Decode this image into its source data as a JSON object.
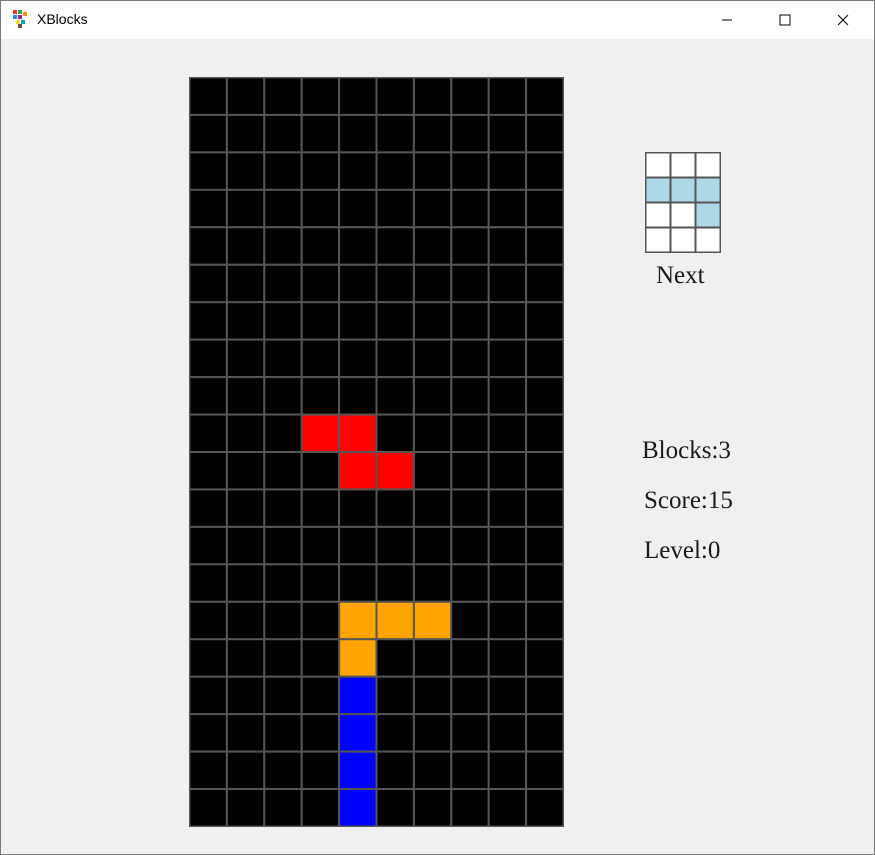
{
  "window": {
    "title": "XBlocks",
    "app_icon": "xblocks-app-icon",
    "controls": {
      "minimize_icon": "minimize-icon",
      "maximize_icon": "maximize-icon",
      "close_icon": "close-icon"
    }
  },
  "board": {
    "columns": 10,
    "rows": 20,
    "background_color": "#000000",
    "grid_line_color": "#555555",
    "filled_cells": [
      {
        "row": 9,
        "col": 3,
        "color": "#ff0000"
      },
      {
        "row": 9,
        "col": 4,
        "color": "#ff0000"
      },
      {
        "row": 10,
        "col": 4,
        "color": "#ff0000"
      },
      {
        "row": 10,
        "col": 5,
        "color": "#ff0000"
      },
      {
        "row": 14,
        "col": 4,
        "color": "#ffa500"
      },
      {
        "row": 14,
        "col": 5,
        "color": "#ffa500"
      },
      {
        "row": 14,
        "col": 6,
        "color": "#ffa500"
      },
      {
        "row": 15,
        "col": 4,
        "color": "#ffa500"
      },
      {
        "row": 16,
        "col": 4,
        "color": "#0000ff"
      },
      {
        "row": 17,
        "col": 4,
        "color": "#0000ff"
      },
      {
        "row": 18,
        "col": 4,
        "color": "#0000ff"
      },
      {
        "row": 19,
        "col": 4,
        "color": "#0000ff"
      }
    ]
  },
  "next_piece": {
    "label": "Next",
    "columns": 3,
    "rows": 4,
    "empty_color": "#ffffff",
    "grid_line_color": "#555555",
    "filled_cells": [
      {
        "row": 1,
        "col": 0,
        "color": "#add8e6"
      },
      {
        "row": 1,
        "col": 1,
        "color": "#add8e6"
      },
      {
        "row": 1,
        "col": 2,
        "color": "#add8e6"
      },
      {
        "row": 2,
        "col": 2,
        "color": "#add8e6"
      }
    ]
  },
  "stats": {
    "blocks": "Blocks:3",
    "score": "Score:15",
    "level": "Level:0"
  }
}
